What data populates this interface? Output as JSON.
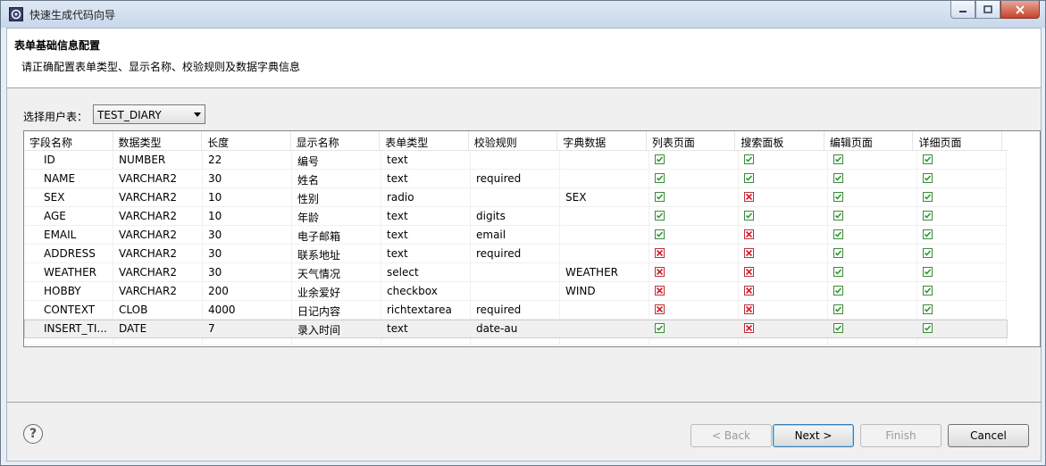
{
  "window": {
    "title": "快速生成代码向导"
  },
  "header": {
    "title": "表单基础信息配置",
    "description": "请正确配置表单类型、显示名称、校验规则及数据字典信息"
  },
  "table_select": {
    "label": "选择用户表：",
    "value": "TEST_DIARY"
  },
  "columns": [
    "字段名称",
    "数据类型",
    "长度",
    "显示名称",
    "表单类型",
    "校验规则",
    "字典数据",
    "列表页面",
    "搜索面板",
    "编辑页面",
    "详细页面"
  ],
  "rows": [
    {
      "field": "ID",
      "type": "NUMBER",
      "length": "22",
      "display": "编号",
      "form": "text",
      "rule": "",
      "dict": "",
      "list": true,
      "search": true,
      "edit": true,
      "detail": true
    },
    {
      "field": "NAME",
      "type": "VARCHAR2",
      "length": "30",
      "display": "姓名",
      "form": "text",
      "rule": "required",
      "dict": "",
      "list": true,
      "search": true,
      "edit": true,
      "detail": true
    },
    {
      "field": "SEX",
      "type": "VARCHAR2",
      "length": "10",
      "display": "性别",
      "form": "radio",
      "rule": "",
      "dict": "SEX",
      "list": true,
      "search": false,
      "edit": true,
      "detail": true
    },
    {
      "field": "AGE",
      "type": "VARCHAR2",
      "length": "10",
      "display": "年龄",
      "form": "text",
      "rule": "digits",
      "dict": "",
      "list": true,
      "search": true,
      "edit": true,
      "detail": true
    },
    {
      "field": "EMAIL",
      "type": "VARCHAR2",
      "length": "30",
      "display": "电子邮箱",
      "form": "text",
      "rule": "email",
      "dict": "",
      "list": true,
      "search": false,
      "edit": true,
      "detail": true
    },
    {
      "field": "ADDRESS",
      "type": "VARCHAR2",
      "length": "30",
      "display": "联系地址",
      "form": "text",
      "rule": "required",
      "dict": "",
      "list": false,
      "search": false,
      "edit": true,
      "detail": true
    },
    {
      "field": "WEATHER",
      "type": "VARCHAR2",
      "length": "30",
      "display": "天气情况",
      "form": "select",
      "rule": "",
      "dict": "WEATHER",
      "list": false,
      "search": false,
      "edit": true,
      "detail": true
    },
    {
      "field": "HOBBY",
      "type": "VARCHAR2",
      "length": "200",
      "display": "业余爱好",
      "form": "checkbox",
      "rule": "",
      "dict": "WIND",
      "list": false,
      "search": false,
      "edit": true,
      "detail": true
    },
    {
      "field": "CONTEXT",
      "type": "CLOB",
      "length": "4000",
      "display": "日记内容",
      "form": "richtextarea",
      "rule": "required",
      "dict": "",
      "list": false,
      "search": false,
      "edit": true,
      "detail": true
    },
    {
      "field": "INSERT_TI...",
      "type": "DATE",
      "length": "7",
      "display": "录入时间",
      "form": "text",
      "rule": "date-au",
      "dict": "",
      "list": true,
      "search": false,
      "edit": true,
      "detail": true
    }
  ],
  "buttons": {
    "back": "< Back",
    "next": "Next >",
    "finish": "Finish",
    "cancel": "Cancel",
    "help": "?"
  }
}
